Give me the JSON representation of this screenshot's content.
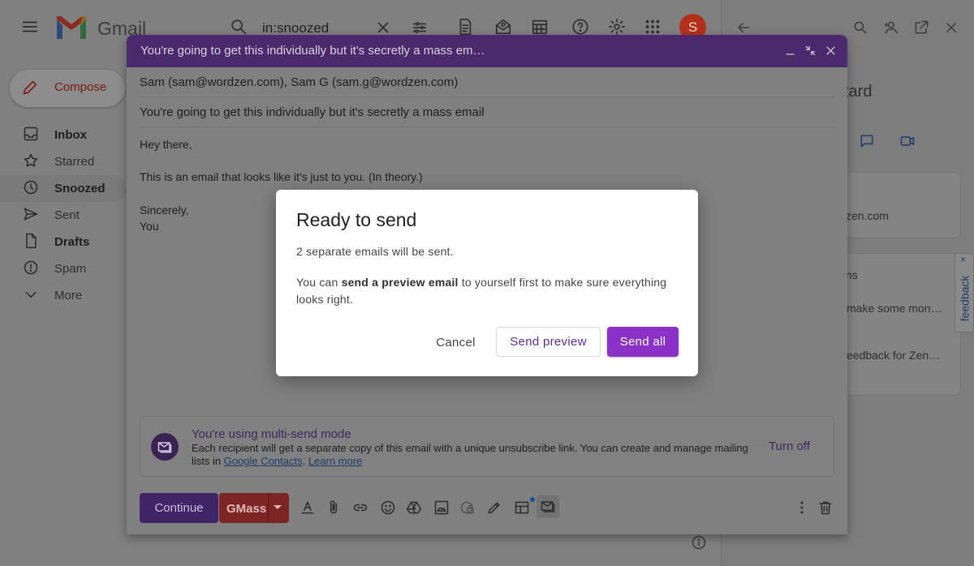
{
  "app": {
    "logo_text": "Gmail"
  },
  "search": {
    "query": "in:snoozed"
  },
  "account": {
    "avatar_letter": "S"
  },
  "sidebar": {
    "compose_label": "Compose",
    "items": [
      {
        "label": "Inbox",
        "icon": "inbox-icon"
      },
      {
        "label": "Starred",
        "icon": "star-icon"
      },
      {
        "label": "Snoozed",
        "icon": "clock-icon"
      },
      {
        "label": "Sent",
        "icon": "send-icon"
      },
      {
        "label": "Drafts",
        "icon": "draft-icon"
      },
      {
        "label": "Spam",
        "icon": "spam-icon"
      },
      {
        "label": "More",
        "icon": "chevron-down-icon"
      }
    ]
  },
  "right_panel": {
    "title_fragment": "tard",
    "email_fragment": "zen.com",
    "section_fragment": "ns",
    "item1_fragment": "make some mon…",
    "item2_fragment": "eedback for Zen…",
    "feedback_label": "feedback",
    "feedback_close": "×"
  },
  "compose": {
    "window_title": "You're going to get this individually but it's secretly a mass em…",
    "to": "Sam (sam@wordzen.com), Sam G (sam.g@wordzen.com)",
    "subject": "You're going to get this individually but it's secretly a mass email",
    "body": {
      "greeting": "Hey there,",
      "line1": "This is an email that looks like it's just to you. (In theory.)",
      "closing": "Sincerely,",
      "signature": "You"
    },
    "multisend": {
      "title": "You're using multi-send mode",
      "desc_prefix": "Each recipient will get a separate copy of this email with a unique unsubscribe link. You can create and manage mailing lists in ",
      "link1": "Google Contacts",
      "desc_mid": ". ",
      "link2": "Learn more",
      "turn_off": "Turn off"
    },
    "toolbar": {
      "continue_label": "Continue",
      "gmass_label": "GMass"
    }
  },
  "dialog": {
    "title": "Ready to send",
    "line1": "2 separate emails will be sent.",
    "line2_prefix": "You can ",
    "line2_bold": "send a preview email",
    "line2_suffix": " to yourself first to make sure everything looks right.",
    "cancel_label": "Cancel",
    "preview_label": "Send preview",
    "send_all_label": "Send all"
  },
  "colors": {
    "dialog_primary": "#8b31c7",
    "compose_header": "#4a2a6a",
    "gmass_red": "#7d2425",
    "avatar": "#b5301b"
  }
}
